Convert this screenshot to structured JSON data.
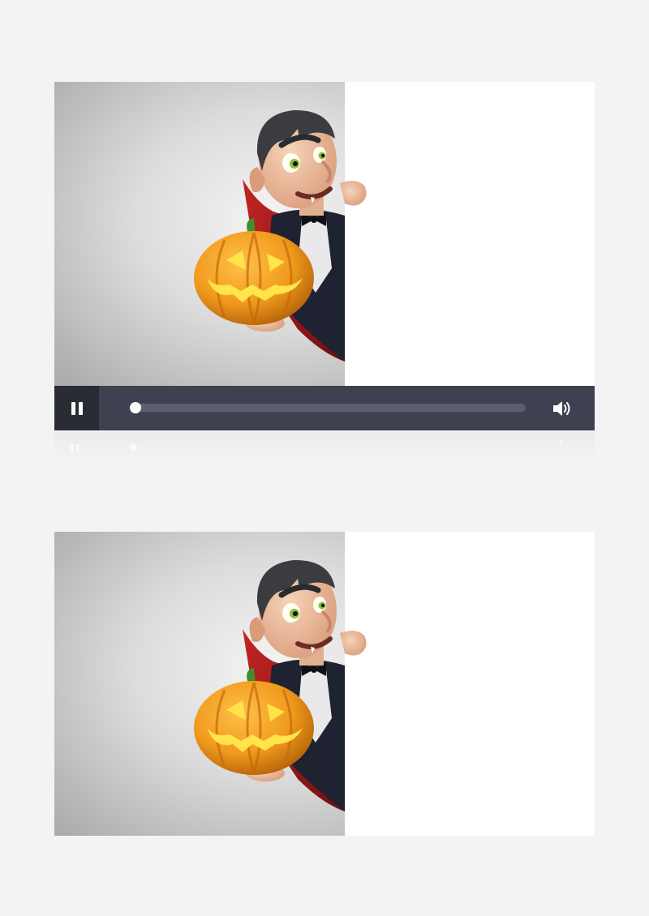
{
  "players": [
    {
      "id": "top",
      "state": "paused-ready",
      "progress": 0.0,
      "controls": {
        "play_pause_icon": "pause-icon",
        "volume_icon": "volume-icon"
      }
    },
    {
      "id": "bottom",
      "state": "frame-preview"
    }
  ],
  "scene": {
    "description_icons": [
      "vampire-character",
      "jack-o-lantern-pumpkin",
      "blank-white-board"
    ]
  },
  "colors": {
    "page_background": "#f3f3f4",
    "control_bar": "#3e4150",
    "control_button_bg": "#2a2c34",
    "progress_track": "#5b5f70",
    "pumpkin_orange": "#f09a1c",
    "pumpkin_glow": "#ffe44a",
    "cape_red": "#9b1c1c"
  }
}
